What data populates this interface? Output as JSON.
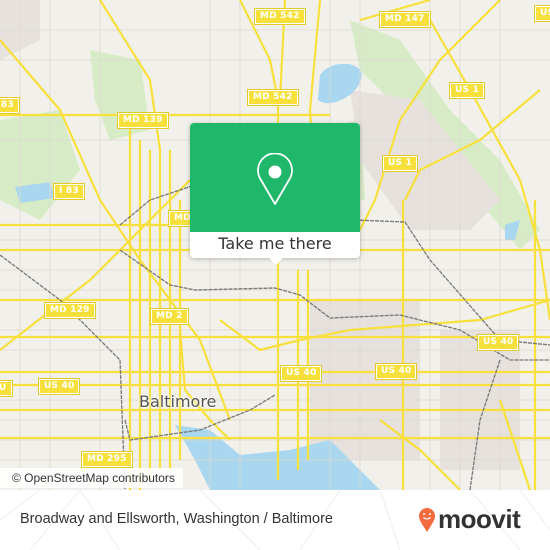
{
  "map": {
    "city_label": "Baltimore",
    "attribution": "© OpenStreetMap contributors",
    "road_shields": [
      {
        "label": "MD 542"
      },
      {
        "label": "MD 147"
      },
      {
        "label": "US"
      },
      {
        "label": "US 1"
      },
      {
        "label": "MD 542"
      },
      {
        "label": "83"
      },
      {
        "label": "MD 139"
      },
      {
        "label": "US 1"
      },
      {
        "label": "I 83"
      },
      {
        "label": "MD"
      },
      {
        "label": "MD 129"
      },
      {
        "label": "MD 2"
      },
      {
        "label": "US 40"
      },
      {
        "label": "US 40"
      },
      {
        "label": "US 40"
      },
      {
        "label": "US 40"
      },
      {
        "label": "U"
      },
      {
        "label": "MD 295"
      }
    ],
    "colors": {
      "background": "#f2f0eb",
      "road": "#f7e03c",
      "water": "#a9d7ef",
      "park": "#d7ecc6"
    }
  },
  "popup": {
    "icon": "location-pin-icon",
    "button_label": "Take me there",
    "color": "#1fb86a"
  },
  "footer": {
    "title": "Broadway and Ellsworth, Washington / Baltimore",
    "logo_text": "moovit",
    "logo_color": "#f26a3d"
  }
}
